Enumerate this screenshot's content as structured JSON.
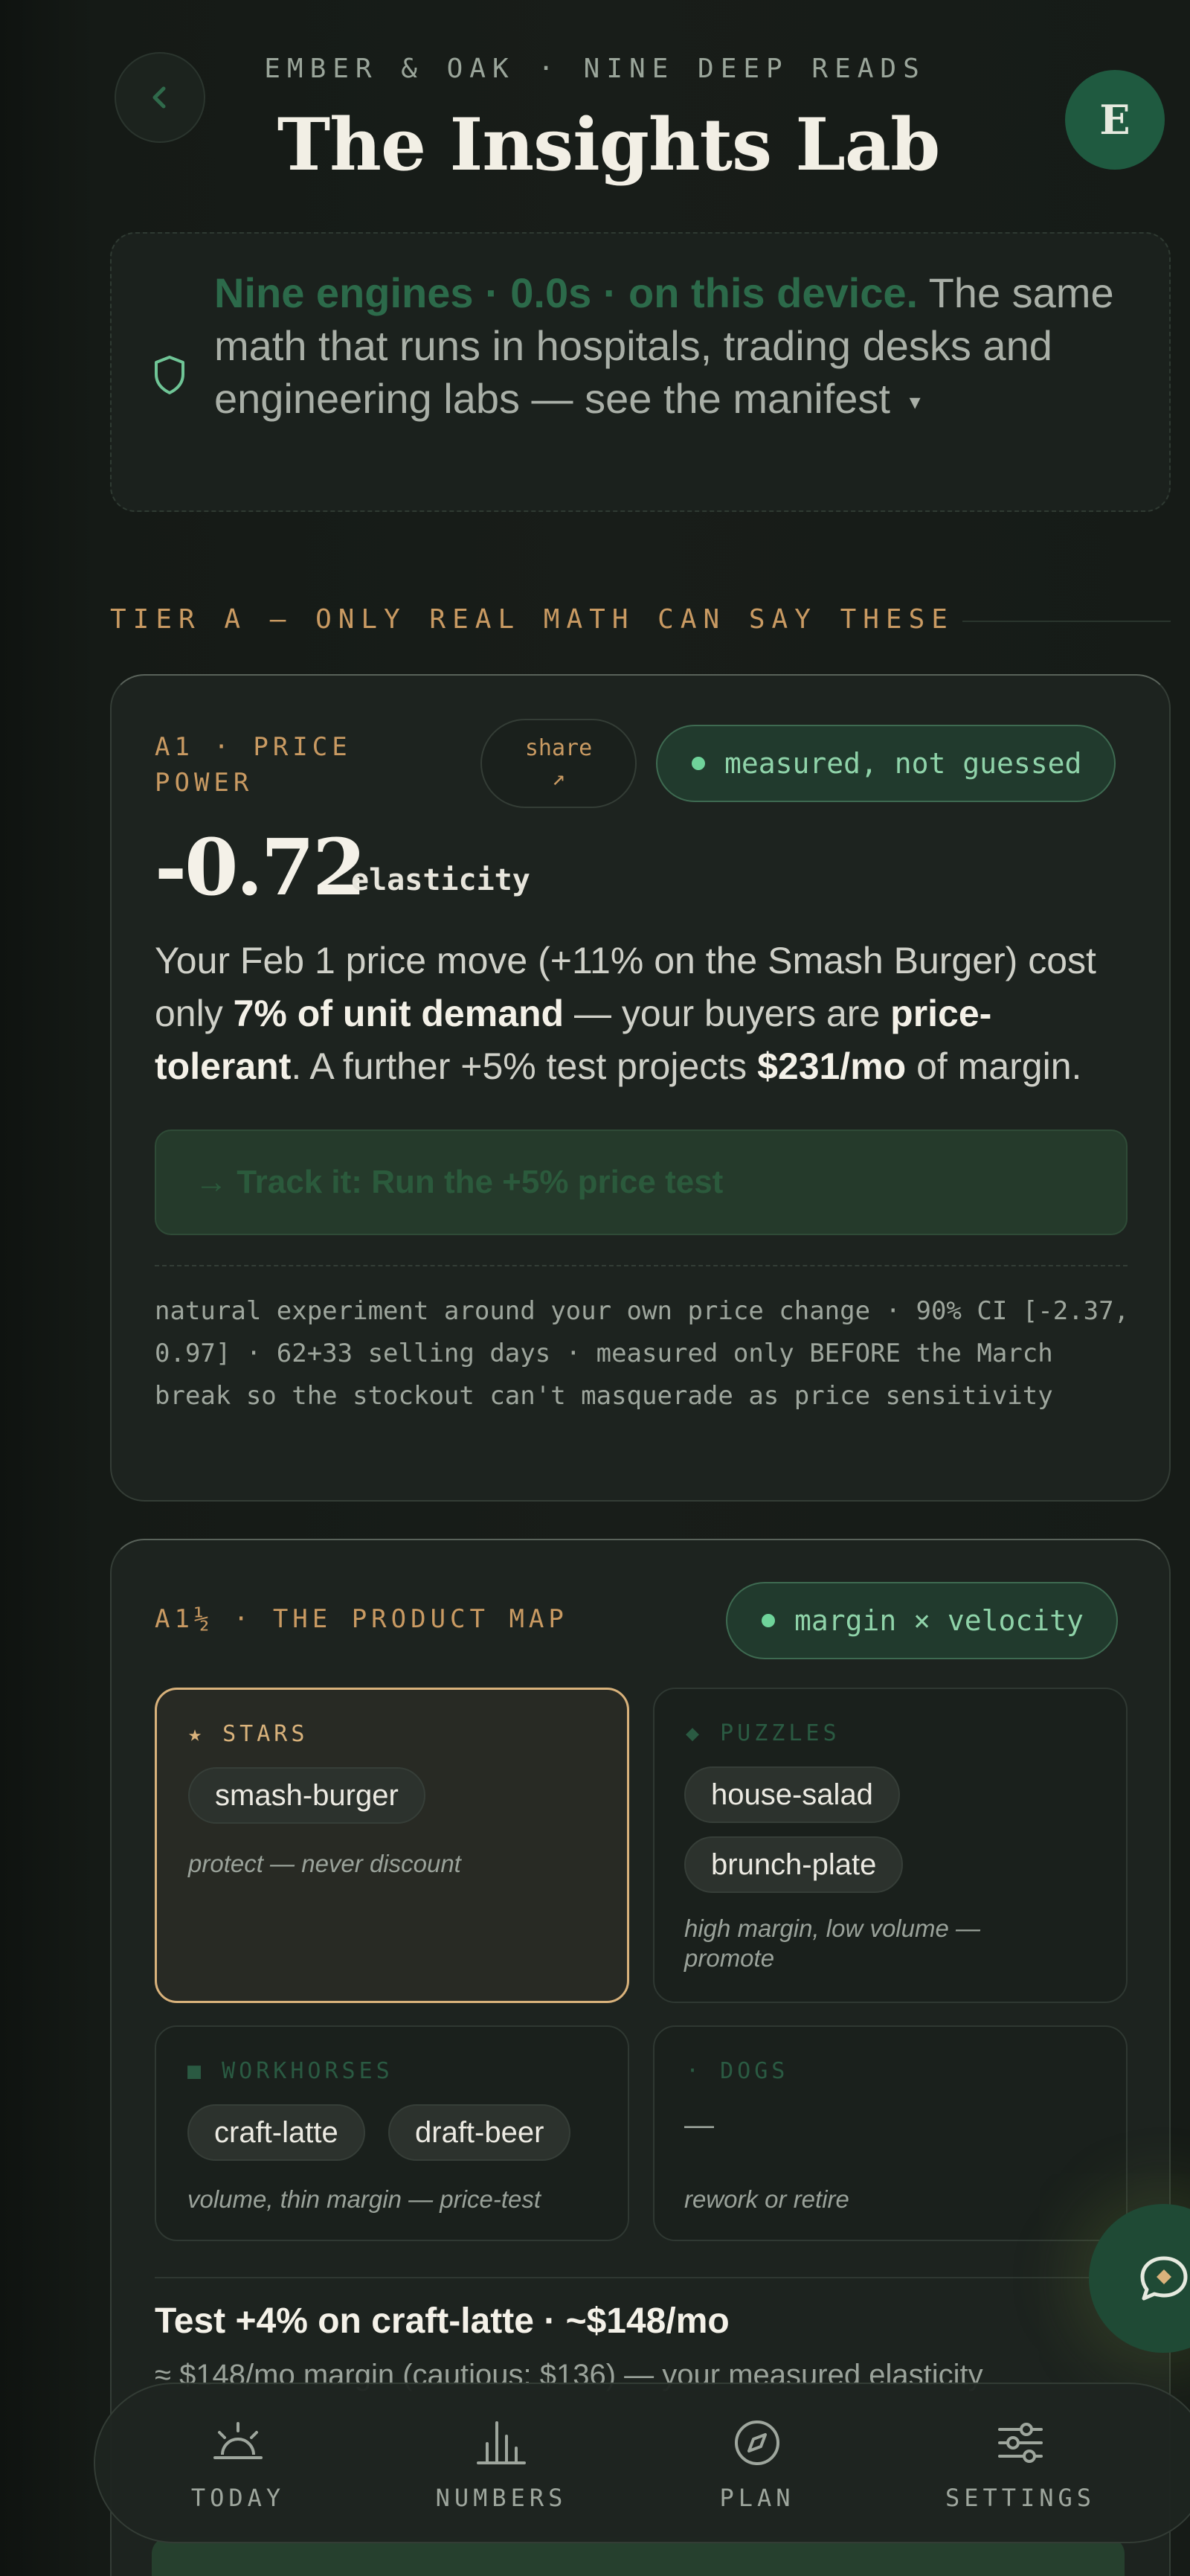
{
  "header": {
    "eyebrow": "EMBER & OAK · NINE DEEP READS",
    "title": "The Insights Lab",
    "avatar_initial": "E"
  },
  "manifest": {
    "lead": "Nine engines · 0.0s · on this device.",
    "rest": "The same math that runs in hospitals, trading desks and engineering labs — see the manifest",
    "caret": "▾"
  },
  "tier_heading": "TIER A — ONLY REAL MATH CAN SAY THESE",
  "card_a1": {
    "label_line1": "A1 · PRICE",
    "label_line2": "POWER",
    "share_label": "share",
    "share_arrow": "↗",
    "badge": "measured, not guessed",
    "value": "-0.72",
    "unit": "elasticity",
    "body": {
      "p1": "Your Feb 1 price move (+11% on the Smash Burger) cost only ",
      "b1": "7% of unit demand",
      "p2": " — your buyers are ",
      "b2": "price-tolerant",
      "p3": ". A further +5% test projects ",
      "b3": "$231/mo",
      "p4": " of margin."
    },
    "cta": "→ Track it: Run the +5% price test",
    "note": "natural experiment around your own price change · 90% CI [-2.37, 0.97] · 62+33 selling days · measured only BEFORE the March break so the stockout can't masquerade as price sensitivity"
  },
  "card_a1half": {
    "label": "A1½ · THE PRODUCT MAP",
    "badge": "margin × velocity",
    "quadrants": {
      "stars": {
        "icon": "★",
        "title": "STARS",
        "items": [
          "smash-burger"
        ],
        "note": "protect — never discount"
      },
      "puzzles": {
        "icon": "◆",
        "title": "PUZZLES",
        "items": [
          "house-salad",
          "brunch-plate"
        ],
        "note": "high margin, low volume — promote"
      },
      "workhorses": {
        "icon": "■",
        "title": "WORKHORSES",
        "items": [
          "craft-latte",
          "draft-beer"
        ],
        "note": "volume, thin margin — price-test"
      },
      "dogs": {
        "icon": "·",
        "title": "DOGS",
        "empty": "—",
        "note": "rework or retire"
      }
    },
    "test_title": "Test +4% on craft-latte · ~$148/mo",
    "test_sub": "≈ $148/mo margin (cautious: $136) — your measured elasticity"
  },
  "nav": {
    "items": [
      {
        "label": "TODAY",
        "icon": "sunrise-icon"
      },
      {
        "label": "NUMBERS",
        "icon": "bar-chart-icon"
      },
      {
        "label": "PLAN",
        "icon": "compass-icon"
      },
      {
        "label": "SETTINGS",
        "icon": "sliders-icon"
      }
    ]
  },
  "colors": {
    "background": "#141915",
    "card": "#1d231f",
    "accent_amber": "#c99a62",
    "accent_green": "#8fd3a9",
    "stars_border": "#d9b27b"
  }
}
